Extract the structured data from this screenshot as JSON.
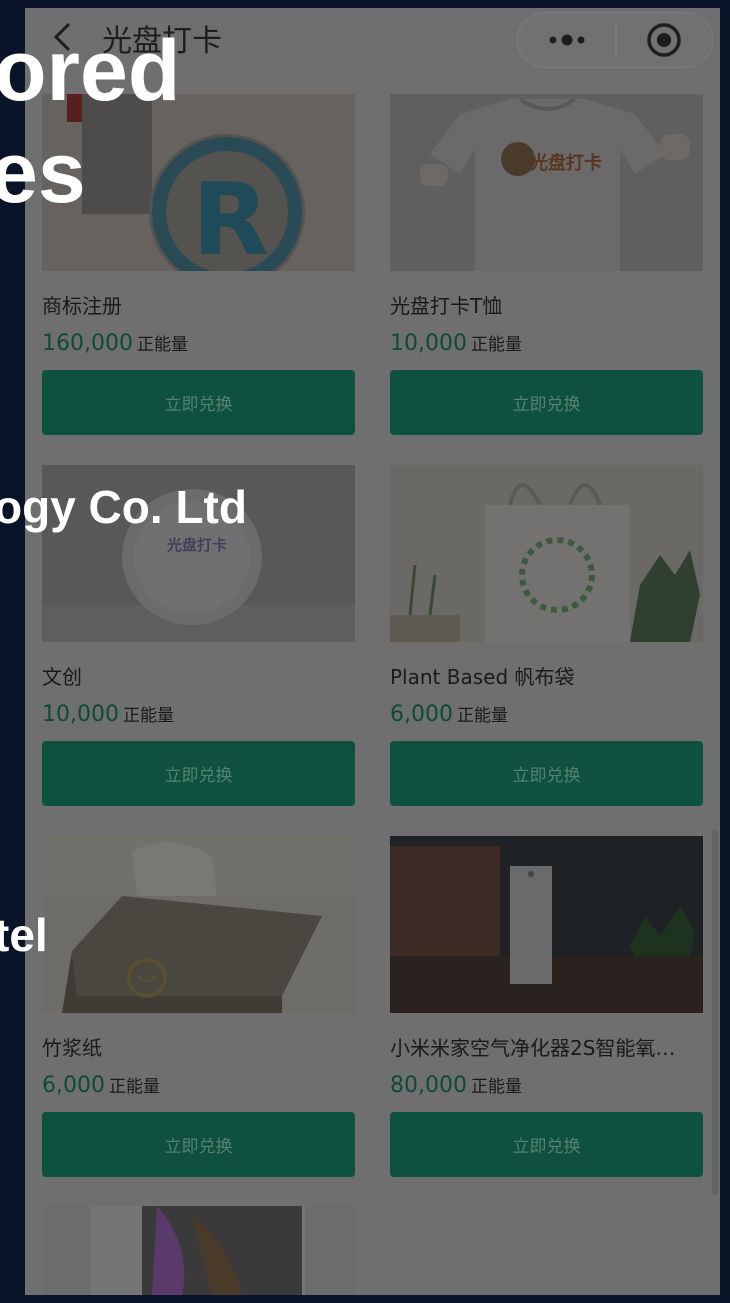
{
  "background_slide": {
    "line1": "ored",
    "line2": "es",
    "line3": "ogy  Co. Ltd",
    "line4": "tel"
  },
  "header": {
    "title": "光盘打卡",
    "back_icon": "chevron-left-icon",
    "more_icon": "more-dots-icon",
    "close_icon": "target-circle-icon"
  },
  "products": [
    {
      "name": "商标注册",
      "price": "160,000",
      "unit": "正能量",
      "button": "立即兑换",
      "image": "registered-trademark"
    },
    {
      "name": "光盘打卡T恤",
      "price": "10,000",
      "unit": "正能量",
      "button": "立即兑换",
      "image": "tshirt"
    },
    {
      "name": "文创",
      "price": "10,000",
      "unit": "正能量",
      "button": "立即兑换",
      "image": "plate"
    },
    {
      "name": "Plant Based 帆布袋",
      "price": "6,000",
      "unit": "正能量",
      "button": "立即兑换",
      "image": "tote-bag"
    },
    {
      "name": "竹浆纸",
      "price": "6,000",
      "unit": "正能量",
      "button": "立即兑换",
      "image": "tissue-box"
    },
    {
      "name": "小米米家空气净化器2S智能氧…",
      "price": "80,000",
      "unit": "正能量",
      "button": "立即兑换",
      "image": "air-purifier"
    }
  ],
  "partial_product": {
    "image": "iphone"
  },
  "colors": {
    "button_bg": "#0e5140",
    "price": "#0e4a3a",
    "overlay": "#6f6f6f"
  }
}
